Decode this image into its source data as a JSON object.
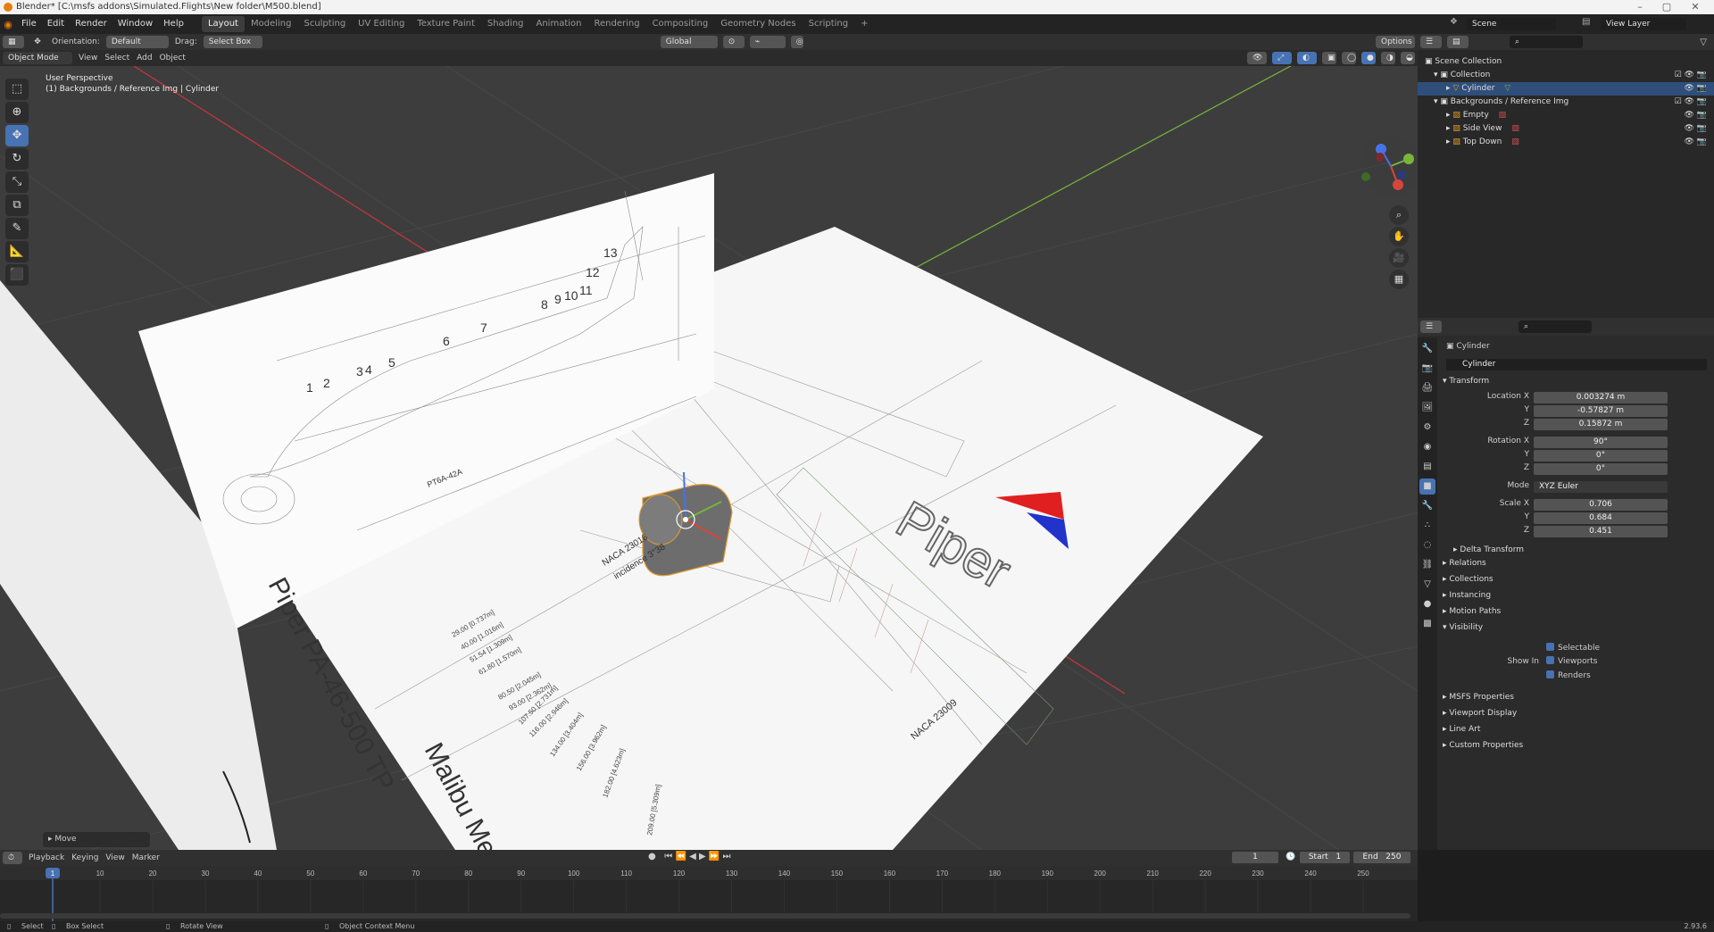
{
  "titlebar": {
    "title": "Blender* [C:\\msfs addons\\Simulated.Flights\\New folder\\M500.blend]"
  },
  "menus": [
    "File",
    "Edit",
    "Render",
    "Window",
    "Help"
  ],
  "workspaces": [
    "Layout",
    "Modeling",
    "Sculpting",
    "UV Editing",
    "Texture Paint",
    "Shading",
    "Animation",
    "Rendering",
    "Compositing",
    "Geometry Nodes",
    "Scripting"
  ],
  "scene": "Scene",
  "view_layer": "View Layer",
  "header": {
    "orientation_label": "Orientation:",
    "orientation_value": "Default",
    "drag_label": "Drag:",
    "drag_value": "Select Box",
    "transform_orientation": "Global",
    "options": "Options"
  },
  "header2": {
    "mode": "Object Mode",
    "items": [
      "View",
      "Select",
      "Add",
      "Object"
    ]
  },
  "viewport": {
    "view_name": "User Perspective",
    "context": "(1) Backgrounds / Reference Img | Cylinder",
    "operator_panel": "Move"
  },
  "blueprint": {
    "title": "Piper PA-46-500 TP",
    "subtitle": "Malibu Meridi",
    "brand": "Piper",
    "airfoil_root": "NACA 23016",
    "incidence": "incidence 3°38",
    "airfoil_tip": "NACA 23009",
    "engine": "PT6A-42A",
    "stations": [
      "1",
      "2",
      "3",
      "4",
      "5",
      "6",
      "7",
      "8",
      "9",
      "10",
      "11",
      "12",
      "13"
    ],
    "dims": [
      "29.00 [0.737m]",
      "40.00 [1.016m]",
      "51.54 [1.309m]",
      "61.80 [1.570m]",
      "80.50 [2.045m]",
      "93.00 [2.362m]",
      "107.50 [2.731m]",
      "116.00 [2.946m]",
      "134.00 [3.404m]",
      "156.00 [3.962m]",
      "182.00 [4.623m]",
      "209.00 [5.309m]"
    ]
  },
  "outliner": {
    "items": [
      {
        "label": "Scene Collection",
        "indent": 0
      },
      {
        "label": "Collection",
        "indent": 1
      },
      {
        "label": "Cylinder",
        "indent": 2,
        "selected": true
      },
      {
        "label": "Backgrounds / Reference Img",
        "indent": 1
      },
      {
        "label": "Empty",
        "indent": 2
      },
      {
        "label": "Side View",
        "indent": 2
      },
      {
        "label": "Top Down",
        "indent": 2
      }
    ]
  },
  "properties": {
    "object_name": "Cylinder",
    "data_name": "Cylinder",
    "transform_header": "Transform",
    "location_label": "Location X",
    "location": [
      "0.003274 m",
      "-0.57827 m",
      "0.15872 m"
    ],
    "rotation_label": "Rotation X",
    "rotation": [
      "90°",
      "0°",
      "0°"
    ],
    "mode_label": "Mode",
    "mode_value": "XYZ Euler",
    "scale_label": "Scale X",
    "scale": [
      "0.706",
      "0.684",
      "0.451"
    ],
    "axis_y": "Y",
    "axis_z": "Z",
    "delta_transform": "Delta Transform",
    "sections": [
      "Relations",
      "Collections",
      "Instancing",
      "Motion Paths"
    ],
    "visibility_header": "Visibility",
    "selectable": "Selectable",
    "show_in_label": "Show In",
    "viewports": "Viewports",
    "renders": "Renders",
    "sections2": [
      "MSFS Properties",
      "Viewport Display",
      "Line Art",
      "Custom Properties"
    ]
  },
  "timeline": {
    "menus": [
      "Playback",
      "Keying",
      "View",
      "Marker"
    ],
    "current_frame": "1",
    "start_label": "Start",
    "start": "1",
    "end_label": "End",
    "end": "250",
    "ruler": [
      "1",
      "10",
      "20",
      "30",
      "40",
      "50",
      "60",
      "70",
      "80",
      "90",
      "100",
      "110",
      "120",
      "130",
      "140",
      "150",
      "160",
      "170",
      "180",
      "190",
      "200",
      "210",
      "220",
      "230",
      "240",
      "250"
    ]
  },
  "statusbar": {
    "items": [
      "Select",
      "Box Select",
      "Rotate View",
      "Object Context Menu"
    ],
    "version": "2.93.6"
  },
  "colors": {
    "accent": "#4772b3",
    "selected_row": "#2f4f7a",
    "x_axis": "#c9363f",
    "y_axis": "#79b53b"
  }
}
